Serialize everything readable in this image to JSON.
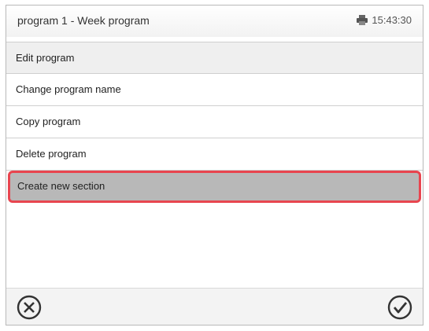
{
  "header": {
    "title": "program 1 - Week program",
    "time": "15:43:30",
    "status_icon": "printer-icon"
  },
  "menu": {
    "title": "Edit program",
    "items": [
      {
        "label": "Change program name",
        "highlighted": false
      },
      {
        "label": "Copy program",
        "highlighted": false
      },
      {
        "label": "Delete program",
        "highlighted": false
      },
      {
        "label": "Create new section",
        "highlighted": true
      }
    ]
  },
  "footer": {
    "cancel_icon": "close-circle-icon",
    "confirm_icon": "checkmark-circle-icon"
  },
  "colors": {
    "highlight_border": "#e8454f",
    "highlight_fill": "#b8b8b8"
  }
}
